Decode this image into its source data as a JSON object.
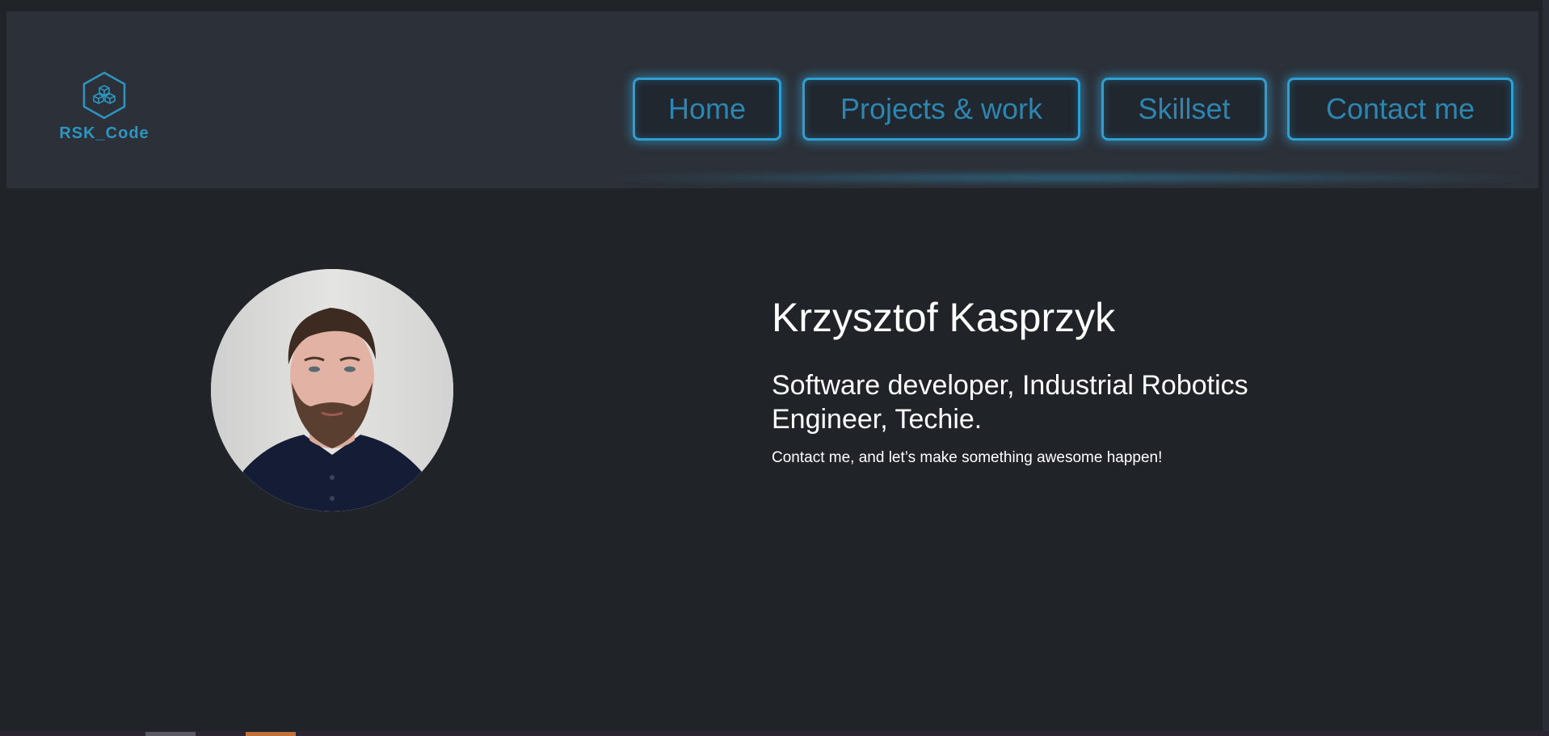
{
  "brand": {
    "logo_icon": "hexagon-cubes-icon",
    "name": "RSK_Code",
    "accent_color": "#2e95c0"
  },
  "nav": {
    "items": [
      {
        "label": "Home"
      },
      {
        "label": "Projects & work"
      },
      {
        "label": "Skillset"
      },
      {
        "label": "Contact me"
      }
    ]
  },
  "hero": {
    "photo_alt": "avatar",
    "name": "Krzysztof Kasprzyk",
    "tagline": "Software developer, Industrial Robotics Engineer, Techie.",
    "cta": "Contact me, and let’s make something awesome happen!"
  },
  "colors": {
    "background": "#202327",
    "header": "#2c3038",
    "neon": "#2f9fd2",
    "text": "#ffffff"
  }
}
